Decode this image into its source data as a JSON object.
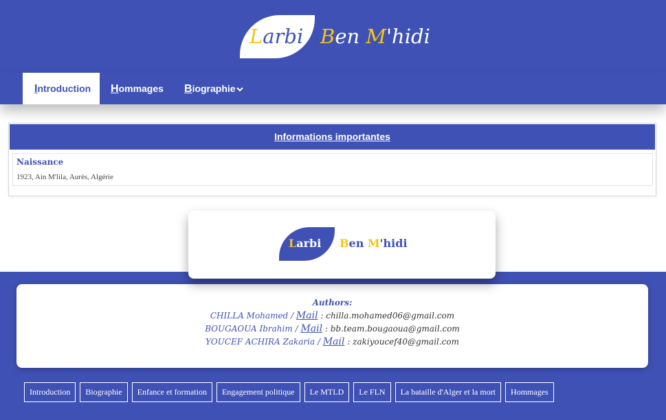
{
  "header": {
    "logo_first": {
      "cap": "L",
      "rest": "arbi"
    },
    "logo_second": [
      {
        "cap": "B",
        "rest": "en"
      },
      {
        "cap": "M",
        "rest": "'hidi"
      }
    ]
  },
  "nav": {
    "items": [
      {
        "first": "I",
        "rest": "ntroduction"
      },
      {
        "first": "H",
        "rest": "ommages"
      },
      {
        "first": "B",
        "rest": "iographie"
      }
    ]
  },
  "info": {
    "title": "Informations importantes",
    "label": "Naissance",
    "value": "1923, Ain M'lila, Aurès, Algérie"
  },
  "authors": {
    "title": "Authors:",
    "link_label": "Mail",
    "list": [
      {
        "name": "CHILLA Mohamed",
        "email": "chilla.mohamed06@gmail.com"
      },
      {
        "name": "BOUGAOUA Ibrahim",
        "email": "bb.team.bougaoua@gmail.com"
      },
      {
        "name": "YOUCEF ACHIRA Zakaria",
        "email": "zakiyoucef40@gmail.com"
      }
    ]
  },
  "footer_links": [
    "Introduction",
    "Biographie",
    "Enfance et formation",
    "Engagement politique",
    "Le MTLD",
    "Le FLN",
    "La bataille d'Alger et la mort",
    "Hommages"
  ],
  "colors": {
    "brand": "#3f51b5",
    "accent": "#f5c518"
  }
}
